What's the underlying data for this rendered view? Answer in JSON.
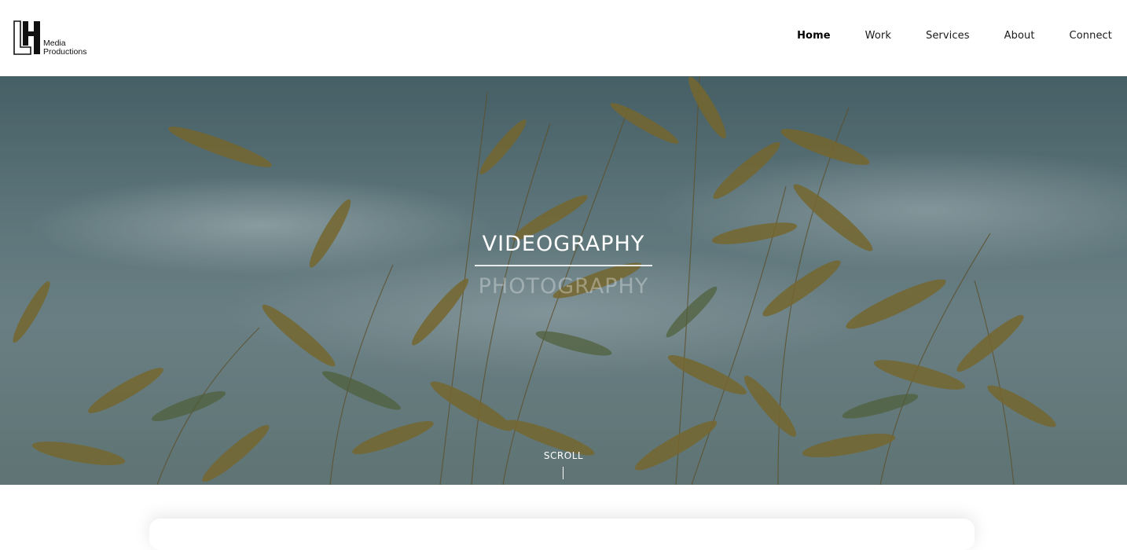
{
  "brand": {
    "logo_line1": "Media",
    "logo_line2": "Productions",
    "logo_icon": "lh-monogram-logo"
  },
  "nav": {
    "items": [
      {
        "label": "Home",
        "active": true
      },
      {
        "label": "Work",
        "active": false
      },
      {
        "label": "Services",
        "active": false
      },
      {
        "label": "About",
        "active": false
      },
      {
        "label": "Connect",
        "active": false
      }
    ]
  },
  "hero": {
    "title": "VIDEOGRAPHY",
    "subtitle": "PHOTOGRAPHY",
    "scroll_label": "SCROLL"
  },
  "colors": {
    "text": "#1a1a1a",
    "hero_text": "#ffffff",
    "background": "#ffffff"
  }
}
